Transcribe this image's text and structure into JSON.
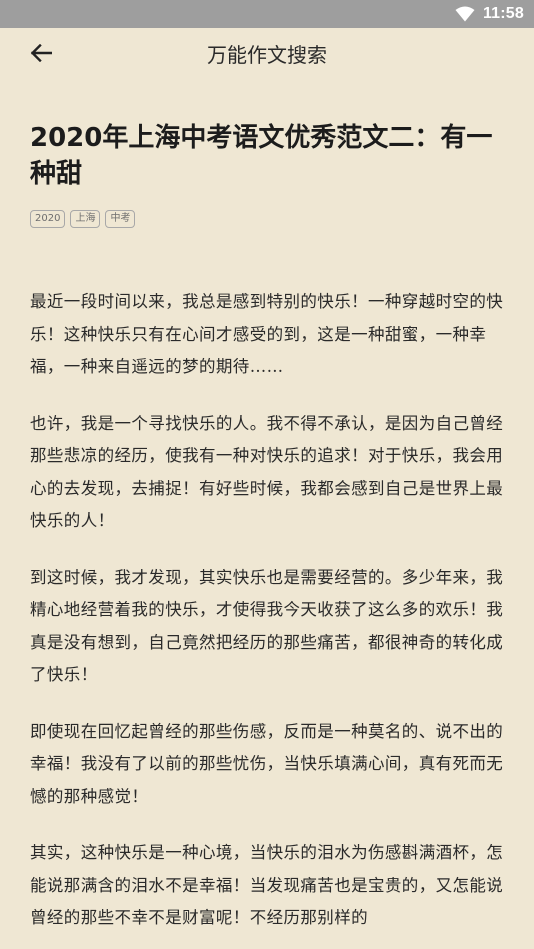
{
  "status_bar": {
    "time": "11:58"
  },
  "toolbar": {
    "title": "万能作文搜索"
  },
  "article": {
    "title": "2020年上海中考语文优秀范文二：有一种甜",
    "tags": [
      "2020",
      "上海",
      "中考"
    ],
    "paragraphs": [
      "最近一段时间以来，我总是感到特别的快乐！一种穿越时空的快乐！这种快乐只有在心间才感受的到，这是一种甜蜜，一种幸福，一种来自遥远的梦的期待……",
      "也许，我是一个寻找快乐的人。我不得不承认，是因为自己曾经那些悲凉的经历，使我有一种对快乐的追求！对于快乐，我会用心的去发现，去捕捉！有好些时候，我都会感到自己是世界上最快乐的人！",
      "到这时候，我才发现，其实快乐也是需要经营的。多少年来，我精心地经营着我的快乐，才使得我今天收获了这么多的欢乐！我真是没有想到，自己竟然把经历的那些痛苦，都很神奇的转化成了快乐！",
      "即使现在回忆起曾经的那些伤感，反而是一种莫名的、说不出的幸福！我没有了以前的那些忧伤，当快乐填满心间，真有死而无憾的那种感觉！",
      "其实，这种快乐是一种心境，当快乐的泪水为伤感斟满酒杯，怎能说那满含的泪水不是幸福！当发现痛苦也是宝贵的，又怎能说曾经的那些不幸不是财富呢！不经历那别样的"
    ]
  },
  "icons": {
    "back": "arrow-left-icon",
    "wifi": "wifi-icon"
  },
  "colors": {
    "background": "#efe7d3",
    "status_bar": "#9e9e9e",
    "text": "#2a2a2a"
  }
}
